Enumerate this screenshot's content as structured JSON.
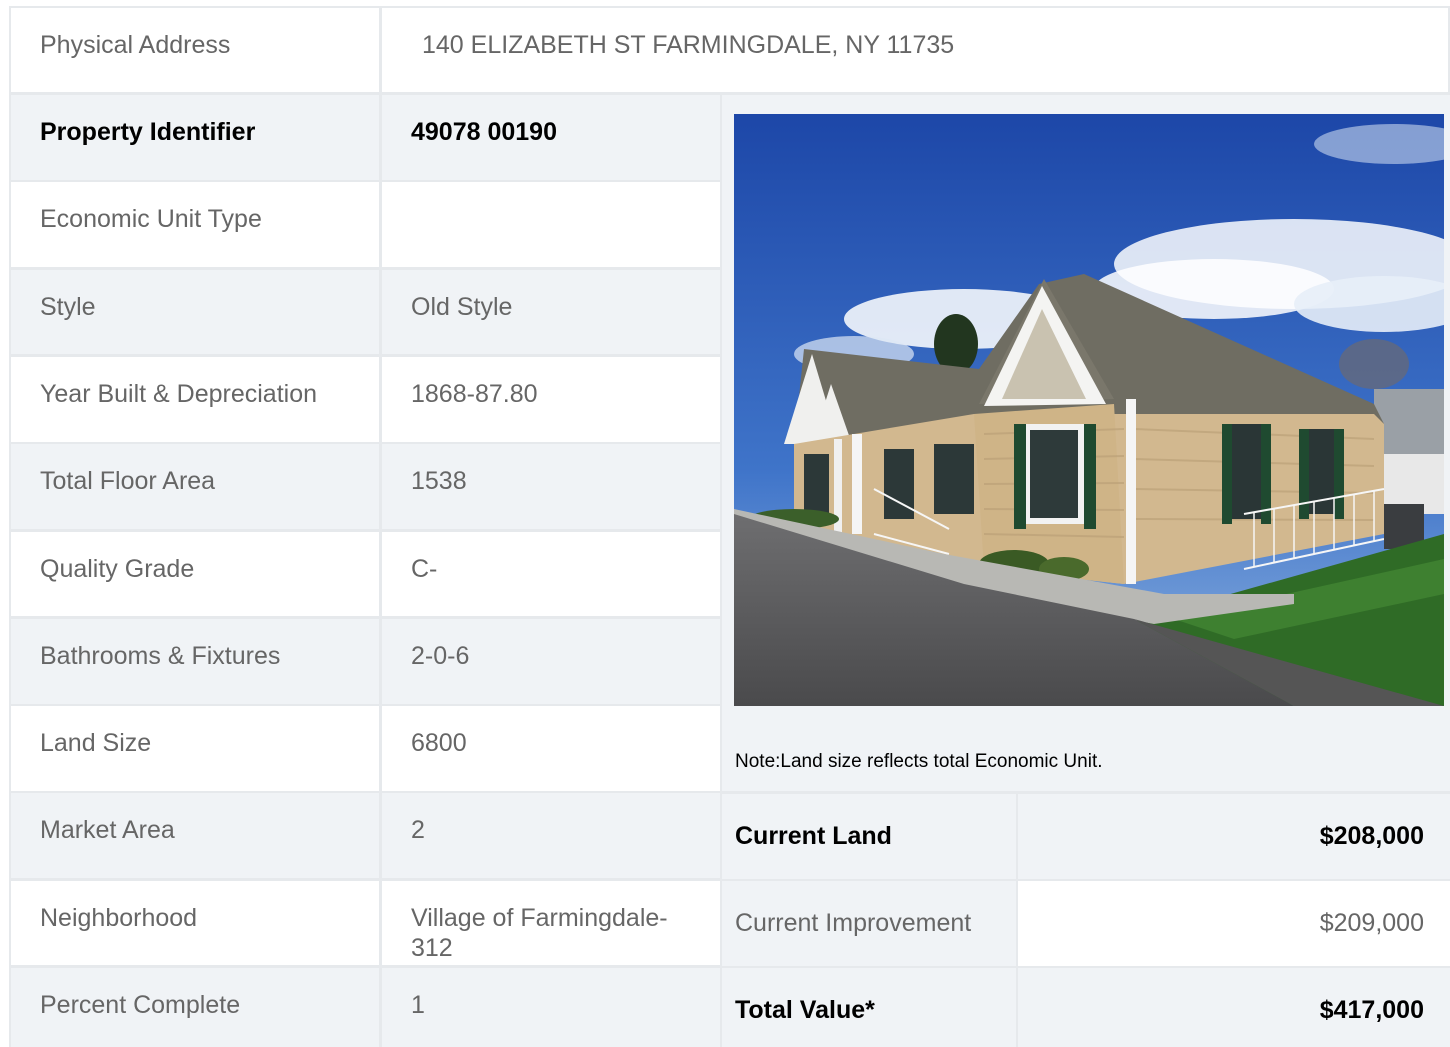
{
  "address": {
    "label": "Physical Address",
    "value": "140  ELIZABETH ST  FARMINGDALE, NY  11735"
  },
  "rows": [
    {
      "label": "Property Identifier",
      "value": "49078  00190",
      "bold": true
    },
    {
      "label": "Economic Unit Type",
      "value": ""
    },
    {
      "label": "Style",
      "value": "Old Style"
    },
    {
      "label": "Year Built & Depreciation",
      "value": "1868-87.80"
    },
    {
      "label": "Total Floor Area",
      "value": "1538"
    },
    {
      "label": "Quality Grade",
      "value": "C-"
    },
    {
      "label": "Bathrooms & Fixtures",
      "value": "2-0-6"
    },
    {
      "label": "Land Size",
      "value": "6800"
    },
    {
      "label": "Market Area",
      "value": "2"
    },
    {
      "label": "Neighborhood",
      "value": "Village of Farmingdale-312"
    },
    {
      "label": "Percent Complete",
      "value": "1"
    }
  ],
  "note": "Note:Land size reflects total Economic Unit.",
  "values": [
    {
      "label": "Current Land",
      "value": "$208,000",
      "bold": true
    },
    {
      "label": "Current Improvement",
      "value": "$209,000",
      "bold": false
    },
    {
      "label": "Total Value*",
      "value": "$417,000",
      "bold": true
    }
  ],
  "colors": {
    "shade": "#f0f3f6",
    "border": "#e6e9ec",
    "label_text": "#666666"
  }
}
